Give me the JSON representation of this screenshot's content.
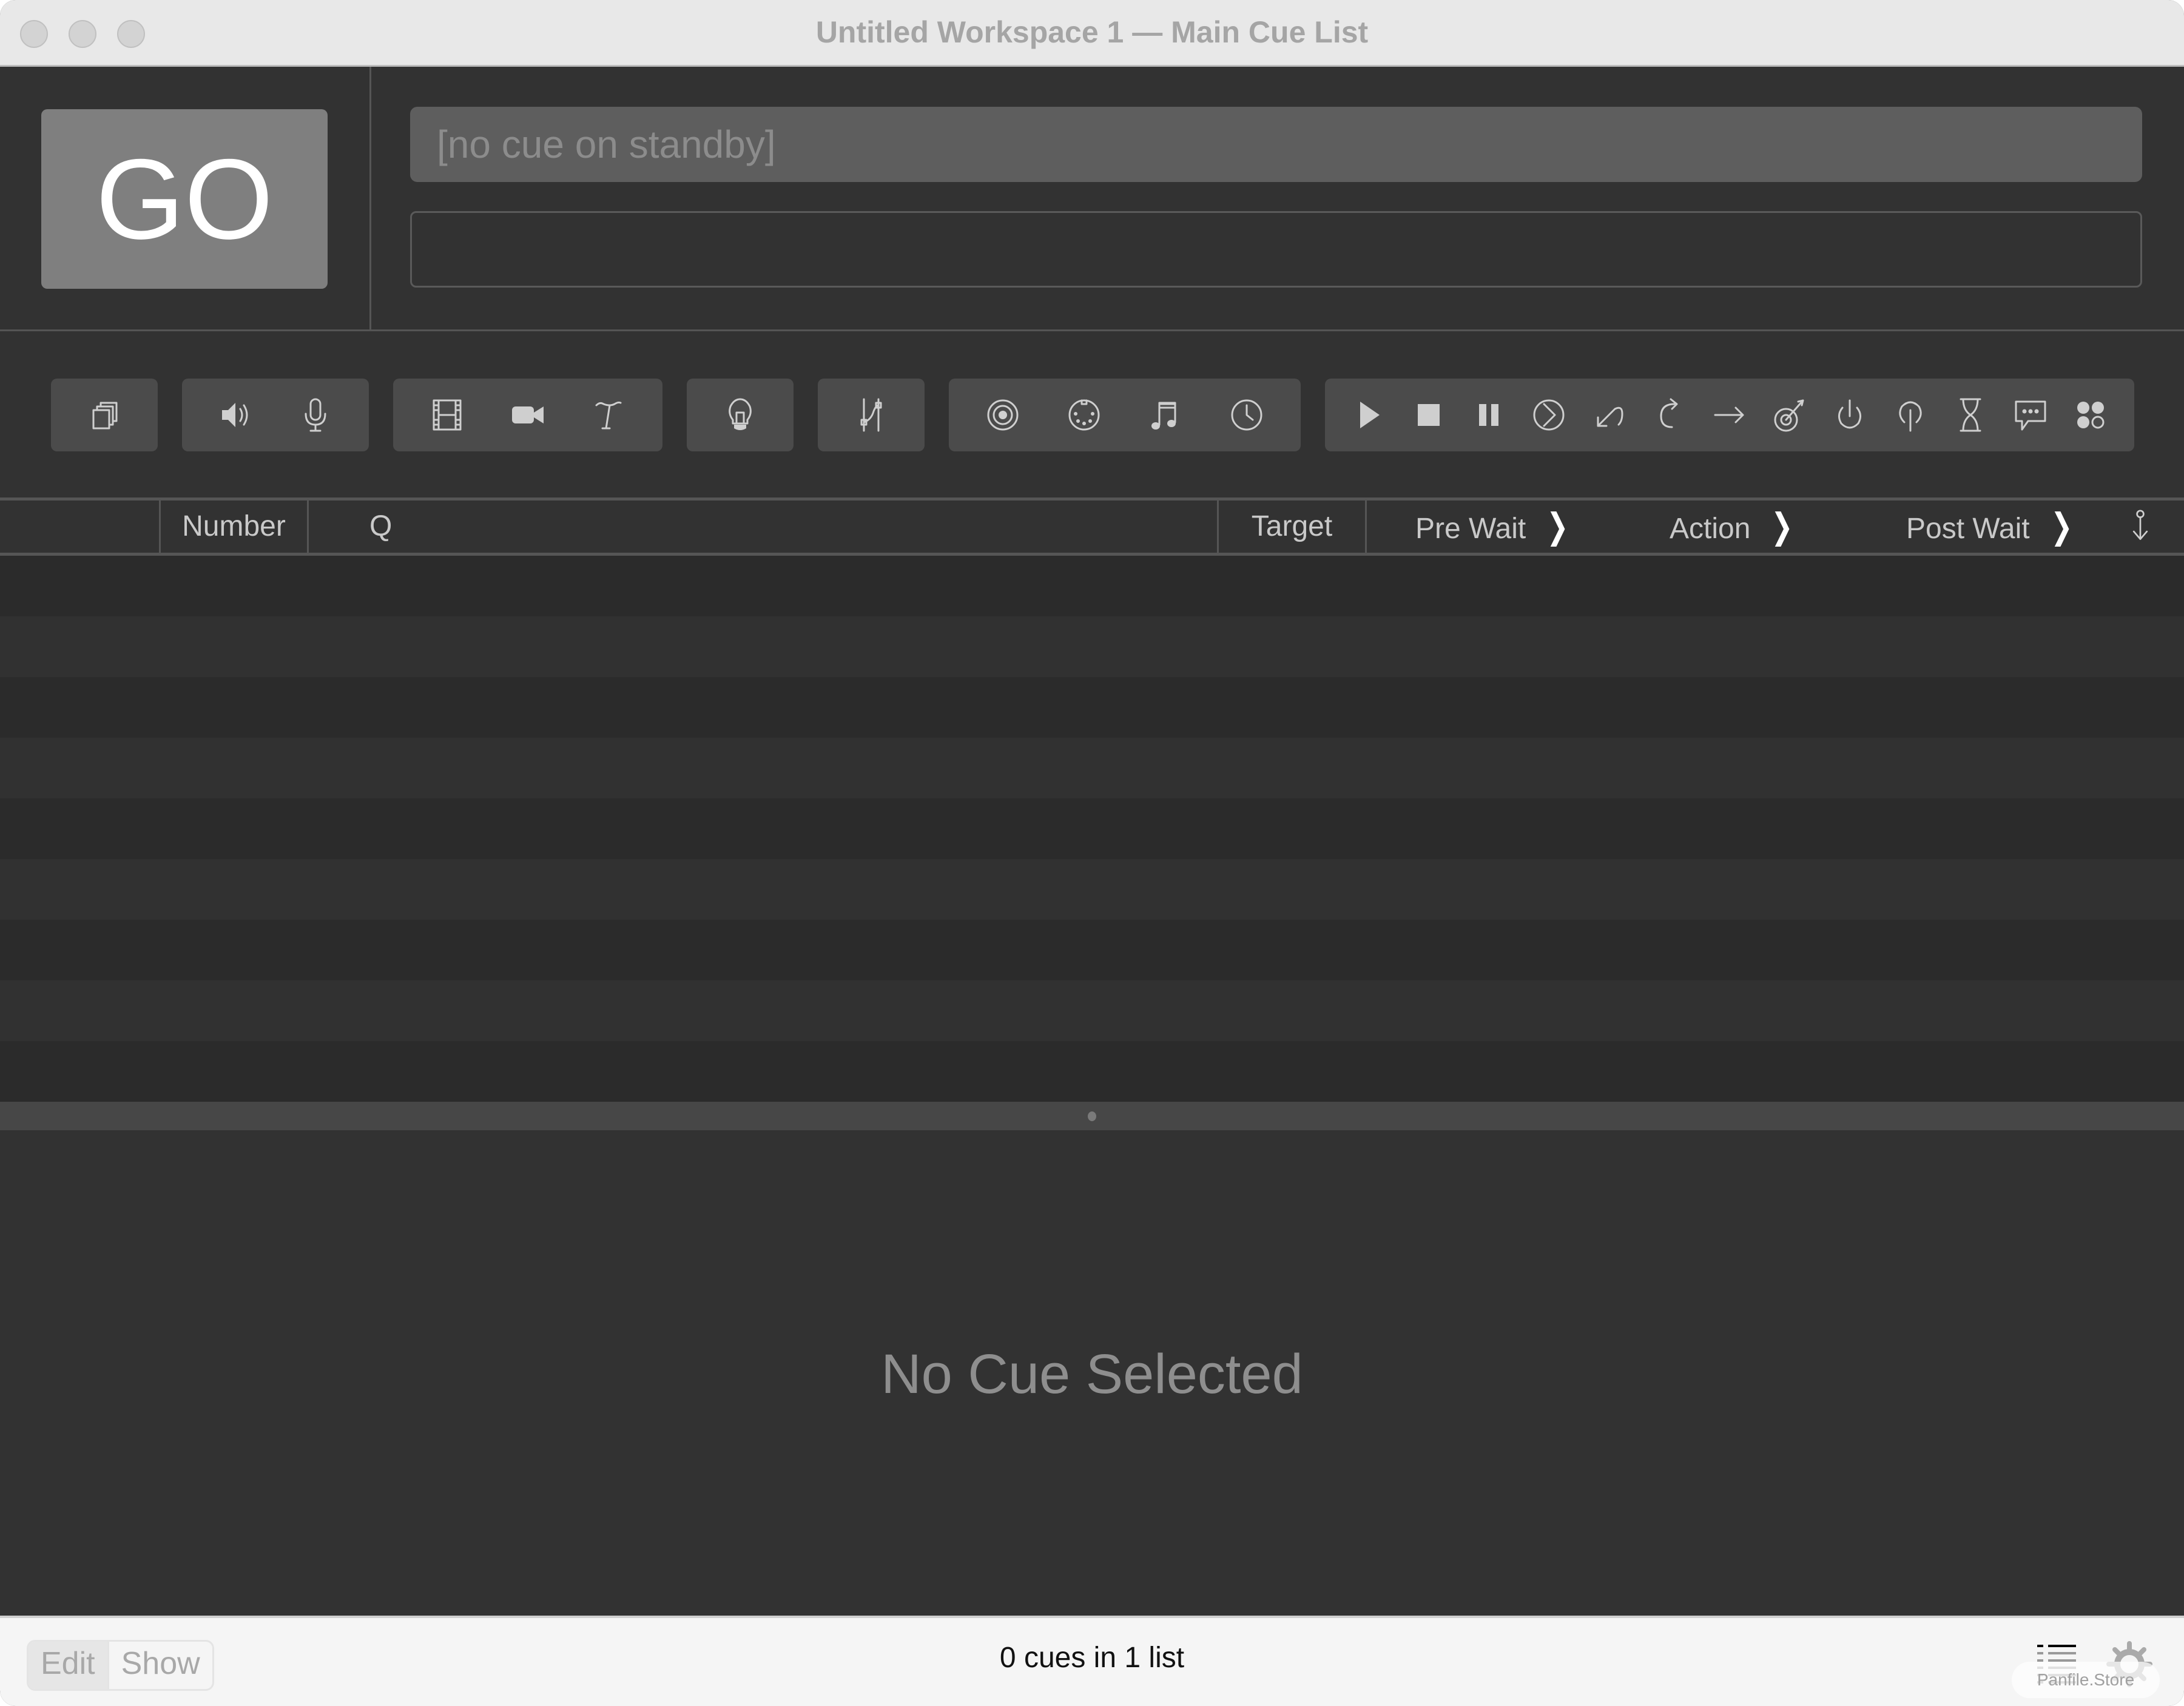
{
  "window": {
    "title": "Untitled Workspace 1 — Main Cue List"
  },
  "top": {
    "go_label": "GO",
    "standby_text": "[no cue on standby]",
    "notes_value": ""
  },
  "toolbar": {
    "groups": [
      {
        "name": "group",
        "icons": [
          "group-cue-icon"
        ]
      },
      {
        "name": "audio",
        "icons": [
          "audio-cue-icon",
          "mic-cue-icon"
        ]
      },
      {
        "name": "video",
        "icons": [
          "video-cue-icon",
          "camera-cue-icon",
          "text-cue-icon"
        ]
      },
      {
        "name": "light",
        "icons": [
          "light-cue-icon"
        ]
      },
      {
        "name": "fade",
        "icons": [
          "fade-cue-icon"
        ]
      },
      {
        "name": "network",
        "icons": [
          "network-cue-icon",
          "midi-cue-icon",
          "midi-file-cue-icon",
          "timecode-cue-icon"
        ]
      },
      {
        "name": "control",
        "icons": [
          "start-cue-icon",
          "stop-cue-icon",
          "pause-cue-icon",
          "load-cue-icon",
          "reset-cue-icon",
          "devamp-cue-icon",
          "goto-cue-icon",
          "target-cue-icon",
          "arm-cue-icon",
          "disarm-cue-icon",
          "wait-cue-icon",
          "memo-cue-icon",
          "script-cue-icon"
        ]
      }
    ]
  },
  "table": {
    "columns": [
      {
        "label": ""
      },
      {
        "label": "Number"
      },
      {
        "label": "Q"
      },
      {
        "label": "Target"
      },
      {
        "label": "Pre Wait"
      },
      {
        "label": "Action"
      },
      {
        "label": "Post Wait"
      },
      {
        "label": ""
      }
    ],
    "chevron": "❯",
    "rows": []
  },
  "inspector": {
    "empty_text": "No Cue Selected"
  },
  "status": {
    "modes": [
      "Edit",
      "Show"
    ],
    "active_mode": "Edit",
    "summary": "0 cues in 1 list",
    "watermark": "Panfile.Store"
  }
}
